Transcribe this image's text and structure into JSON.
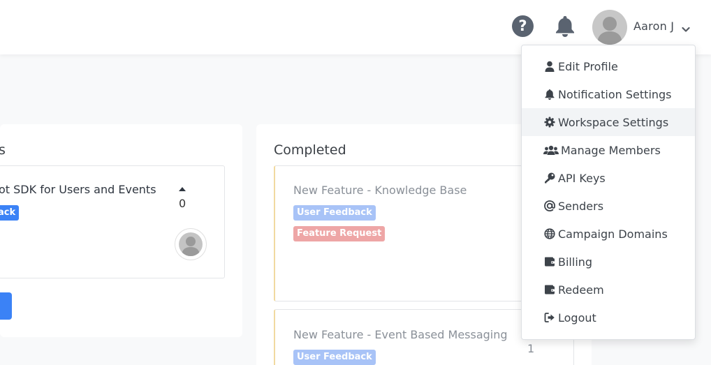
{
  "header": {
    "help_icon_glyph": "?",
    "user_name": "Aaron J"
  },
  "columns": {
    "left": {
      "title": "s",
      "item": {
        "title": "ot SDK for Users and Events",
        "tag": "ack",
        "votes": "0"
      }
    },
    "completed": {
      "title": "Completed",
      "items": [
        {
          "title": "New Feature - Knowledge Base",
          "tags": [
            "User Feedback",
            "Feature Request"
          ]
        },
        {
          "title": "New Feature - Event Based Messaging",
          "tags": [
            "User Feedback"
          ],
          "votes": "1"
        }
      ]
    }
  },
  "menu": {
    "items": [
      {
        "label": "Edit Profile",
        "icon": "user-icon"
      },
      {
        "label": "Notification Settings",
        "icon": "bell-icon"
      },
      {
        "label": "Workspace Settings",
        "icon": "gear-icon"
      },
      {
        "label": "Manage Members",
        "icon": "users-icon"
      },
      {
        "label": "API Keys",
        "icon": "key-icon"
      },
      {
        "label": "Senders",
        "icon": "at-icon"
      },
      {
        "label": "Campaign Domains",
        "icon": "globe-icon"
      },
      {
        "label": "Billing",
        "icon": "wallet-icon"
      },
      {
        "label": "Redeem",
        "icon": "wallet-icon"
      },
      {
        "label": "Logout",
        "icon": "logout-icon"
      }
    ],
    "active_item": "Workspace Settings"
  },
  "colors": {
    "accent_blue": "#3b82f6",
    "tag_blue_light": "#a8c3f7",
    "tag_red_light": "#eea6a6",
    "completed_border": "#f1d9a0",
    "icon_dark": "#5a6370"
  }
}
